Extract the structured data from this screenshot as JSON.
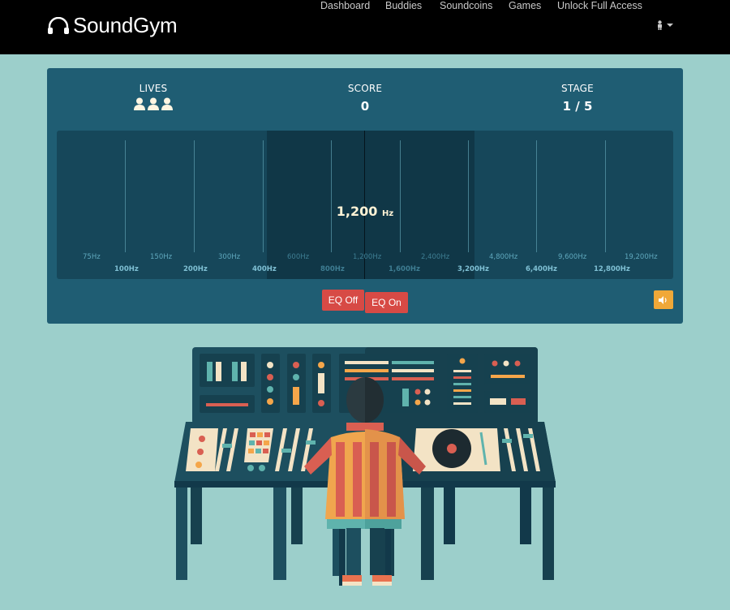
{
  "app": {
    "name": "SoundGym",
    "logo_icon": "headphones-icon"
  },
  "nav": {
    "items": [
      {
        "label": "Dashboard"
      },
      {
        "label": "Buddies"
      },
      {
        "label": "Soundcoins"
      },
      {
        "label": "Games"
      },
      {
        "label": "Unlock Full Access"
      }
    ],
    "user_menu_icon": "user-icon",
    "user_menu_caret": "caret-down-icon"
  },
  "game": {
    "lives_label": "LIVES",
    "lives_count": 3,
    "score_label": "SCORE",
    "score_value": "0",
    "stage_label": "STAGE",
    "stage_value": "1 / 5",
    "current_frequency": "1,200",
    "current_frequency_unit": "Hz",
    "frequency_labels_upper": [
      "75Hz",
      "150Hz",
      "300Hz",
      "600Hz",
      "1,200Hz",
      "2,400Hz",
      "4,800Hz",
      "9,600Hz",
      "19,200Hz"
    ],
    "frequency_labels_lower": [
      "100Hz",
      "200Hz",
      "400Hz",
      "800Hz",
      "1,600Hz",
      "3,200Hz",
      "6,400Hz",
      "12,800Hz"
    ],
    "eq_off_label": "EQ Off",
    "eq_on_label": "EQ On",
    "sound_icon": "speaker-icon"
  },
  "colors": {
    "background": "#9ccfcb",
    "panel": "#1f5d73",
    "spectrum": "#16475a",
    "band_highlight": "#103747",
    "button_red": "#d74a45",
    "button_orange": "#f0a838"
  }
}
